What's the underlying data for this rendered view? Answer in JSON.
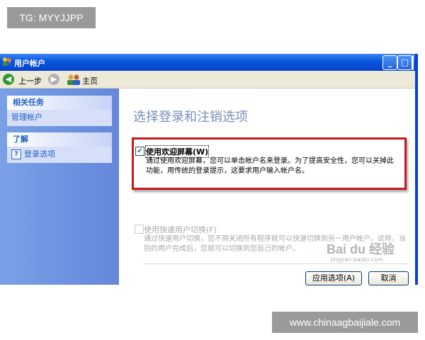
{
  "tg_badge": "TG: MYYJJPP",
  "window": {
    "title": "用户帐户",
    "controls": {
      "minimize": "_",
      "maximize": "□",
      "close": "✕"
    }
  },
  "toolbar": {
    "back_label": "上一步",
    "home_label": "主页",
    "back_icon": "arrow-left-icon",
    "forward_icon": "arrow-right-icon",
    "home_icon": "users-icon"
  },
  "sidebar": {
    "related_tasks": {
      "header": "相关任务",
      "items": [
        "管理帐户"
      ]
    },
    "learn_about": {
      "header": "了解",
      "items": [
        "登录选项"
      ]
    }
  },
  "content": {
    "title": "选择登录和注销选项",
    "option_welcome": {
      "checked": true,
      "label": "使用欢迎屏幕(W)",
      "description": "通过使用欢迎屏幕，您可以单击帐户名来登录。为了提高安全性，您可以关掉此功能，用传统的登录提示，这要求用户输入帐户名。"
    },
    "option_fast_switch": {
      "checked": false,
      "label": "使用快速用户切换(F)",
      "description": "通过快速用户切换，您不用关闭所有程序就可以快速切换到另一用户帐户。这样，当别的用户完成后，您就可以切换到您自己的帐户。"
    },
    "apply_button": "应用选项(A)",
    "cancel_button": "取消"
  },
  "watermark": {
    "main": "Bai du 经验",
    "sub": "jingyan.baidu.com"
  },
  "site_badge": "www.chinaagbaijiale.com",
  "colors": {
    "title_bar": "#0a57dc",
    "side_pane": "#7aa1e6",
    "highlight_box": "#c91a1a"
  }
}
